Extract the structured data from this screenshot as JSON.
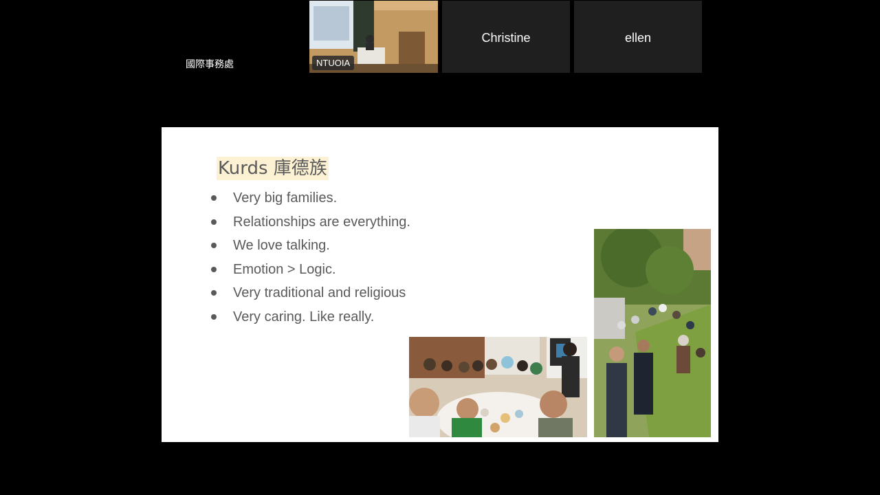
{
  "participants": [
    {
      "name": "國際事務處",
      "type": "name-only"
    },
    {
      "name": "NTUOIA",
      "type": "video"
    },
    {
      "name": "Christine",
      "type": "avatar"
    },
    {
      "name": "ellen",
      "type": "avatar"
    }
  ],
  "slide": {
    "title": "Kurds 庫德族",
    "bullets": [
      "Very big families.",
      "Relationships are everything.",
      "We love talking.",
      "Emotion > Logic.",
      "Very traditional and religious",
      "Very caring. Like really."
    ],
    "colors": {
      "title_highlight": "#fdf1d4",
      "text": "#595959"
    }
  }
}
